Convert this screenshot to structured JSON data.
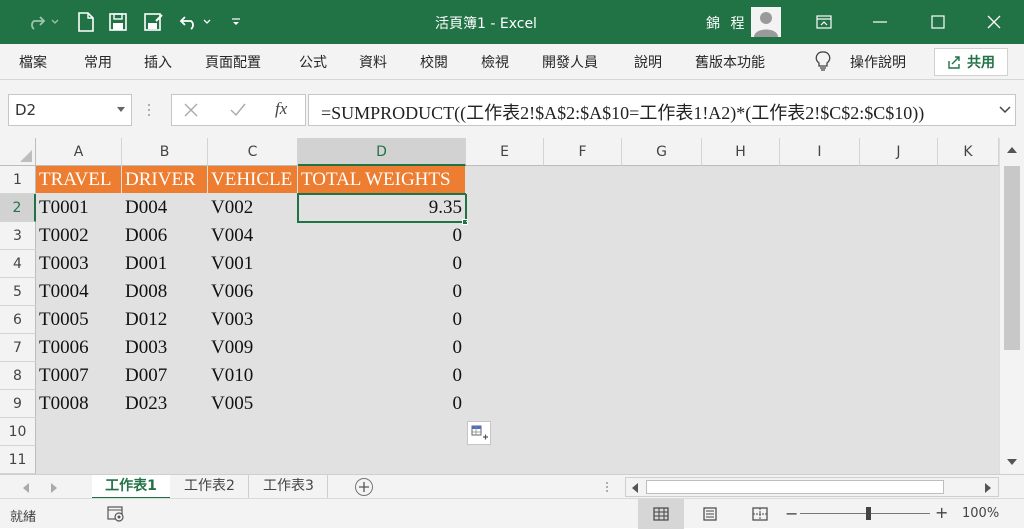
{
  "app": {
    "title": "活頁簿1  -  Excel",
    "user": "錦 程"
  },
  "quick_access": {
    "icons": [
      "redo-icon",
      "new-file-icon",
      "save-icon",
      "save-as-icon",
      "undo-icon",
      "customize-icon"
    ]
  },
  "menu": {
    "items": [
      "檔案",
      "常用",
      "插入",
      "頁面配置",
      "公式",
      "資料",
      "校閱",
      "檢視",
      "開發人員",
      "說明",
      "舊版本功能"
    ],
    "tell_me": "操作說明",
    "share": "共用"
  },
  "formula_bar": {
    "name_box": "D2",
    "fx": "fx",
    "formula": "=SUMPRODUCT((工作表2!$A$2:$A$10=工作表1!A2)*(工作表2!$C$2:$C$10))"
  },
  "sheet": {
    "columns": [
      "A",
      "B",
      "C",
      "D",
      "E",
      "F",
      "G",
      "H",
      "I",
      "J",
      "K"
    ],
    "rows": [
      "1",
      "2",
      "3",
      "4",
      "5",
      "6",
      "7",
      "8",
      "9",
      "10",
      "11"
    ],
    "selected_cell": "D2",
    "header_fill": "#ED7D31",
    "headers": [
      "TRAVEL",
      "DRIVER",
      "VEHICLE",
      "TOTAL WEIGHTS"
    ],
    "data": [
      [
        "T0001",
        "D004",
        "V002",
        "9.35"
      ],
      [
        "T0002",
        "D006",
        "V004",
        "0"
      ],
      [
        "T0003",
        "D001",
        "V001",
        "0"
      ],
      [
        "T0004",
        "D008",
        "V006",
        "0"
      ],
      [
        "T0005",
        "D012",
        "V003",
        "0"
      ],
      [
        "T0006",
        "D003",
        "V009",
        "0"
      ],
      [
        "T0007",
        "D007",
        "V010",
        "0"
      ],
      [
        "T0008",
        "D023",
        "V005",
        "0"
      ]
    ]
  },
  "tabs": [
    "工作表1",
    "工作表2",
    "工作表3"
  ],
  "active_tab": "工作表1",
  "status": {
    "ready": "就緒",
    "zoom": "100%"
  },
  "colors": {
    "brand": "#217346",
    "header_fill": "#ED7D31"
  }
}
